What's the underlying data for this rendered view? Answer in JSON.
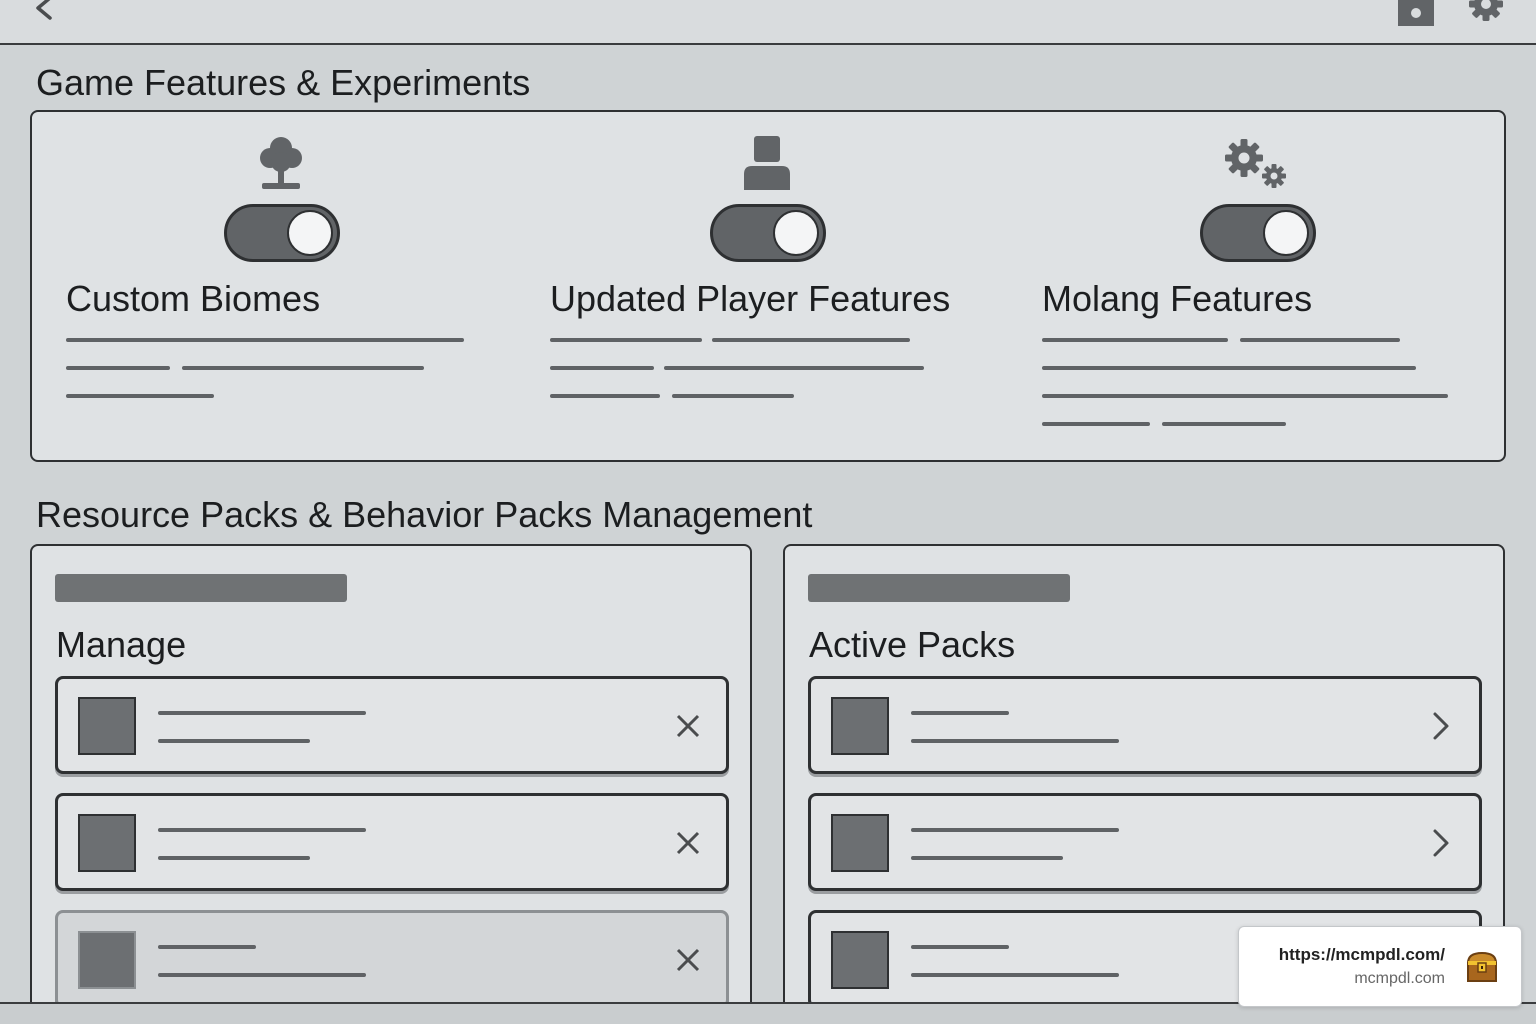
{
  "header": {
    "back_icon": "chevron-left-icon",
    "save_icon": "save-icon",
    "settings_icon": "gear-icon"
  },
  "features_section": {
    "title": "Game Features & Experiments",
    "items": [
      {
        "label": "Custom Biomes",
        "icon": "tree-icon",
        "enabled": true
      },
      {
        "label": "Updated Player Features",
        "icon": "player-icon",
        "enabled": true
      },
      {
        "label": "Molang Features",
        "icon": "gears-icon",
        "enabled": true
      }
    ]
  },
  "packs_section": {
    "title": "Resource Packs & Behavior Packs Management",
    "manage_panel": {
      "title": "Manage",
      "row_action_icon": "close-icon",
      "row_count": 3
    },
    "active_panel": {
      "title": "Active Packs",
      "row_action_icon": "chevron-right-icon",
      "row_count": 3
    }
  },
  "watermark": {
    "url": "https://mcmpdl.com/",
    "domain": "mcmpdl.com",
    "icon": "treasure-chest-icon"
  },
  "colors": {
    "background": "#cfd3d5",
    "panel": "#dfe2e4",
    "toggle_on": "#616467",
    "outline": "#2e3032"
  }
}
